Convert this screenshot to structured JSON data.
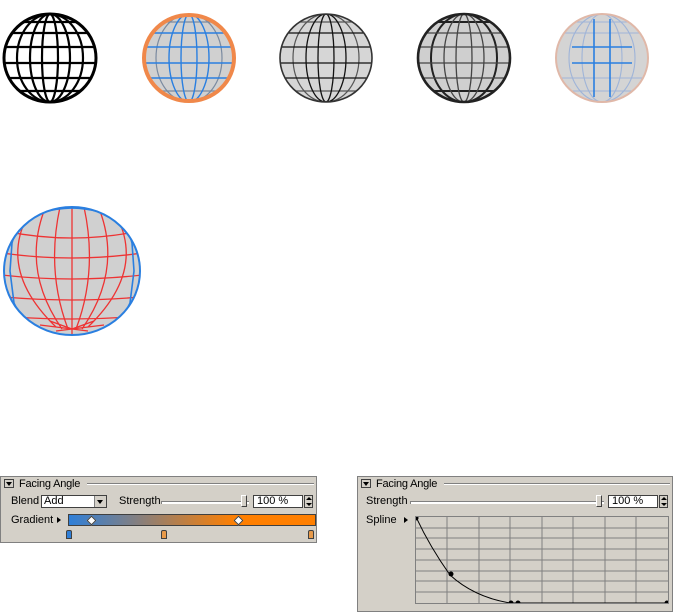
{
  "panel_left": {
    "title": "Facing Angle",
    "blend_label": "Blend",
    "blend_value": "Add",
    "strength_label": "Strength",
    "strength_value": "100 %",
    "strength_level": 1.0,
    "gradient_label": "Gradient",
    "gradient_colors": [
      "#2f7fd8",
      "#ff7f00",
      "#ff7f00"
    ],
    "knot_colors": [
      "#2f7fd8",
      "#e89a4a",
      "#e89a4a"
    ]
  },
  "panel_right": {
    "title": "Facing Angle",
    "strength_label": "Strength",
    "strength_value": "100 %",
    "strength_level": 1.0,
    "spline_label": "Spline"
  },
  "colors": {
    "panel_bg": "#d4d0c8",
    "sphere_fill": "#d0d0d0",
    "orange": "#f0884a",
    "blue": "#2a7fe0",
    "red": "#ee3333"
  }
}
